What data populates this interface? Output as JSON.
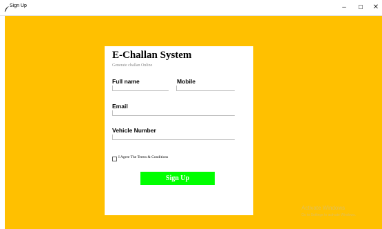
{
  "window": {
    "title": "Sign Up",
    "app_icon": "feather-icon",
    "controls": {
      "minimize": "–",
      "maximize": "☐",
      "close": "✕"
    }
  },
  "form": {
    "heading": "E-Challan System",
    "subheading": "Generate challan Online",
    "fullname_label": "Full name",
    "mobile_label": "Mobile",
    "email_label": "Email",
    "vehicle_label": "Vehicle Number",
    "terms_label": "I Agree The Terms & Conditions",
    "signup_label": "Sign Up",
    "fullname_value": "",
    "mobile_value": "",
    "email_value": "",
    "vehicle_value": "",
    "terms_checked": false
  },
  "colors": {
    "background": "#ffc000",
    "card": "#ffffff",
    "button": "#00ff00",
    "button_text": "#ffffff",
    "subheading": "#8c8c8c"
  },
  "watermark": {
    "line1": "Activate Windows",
    "line2": "Go to Settings to activate Windows."
  }
}
